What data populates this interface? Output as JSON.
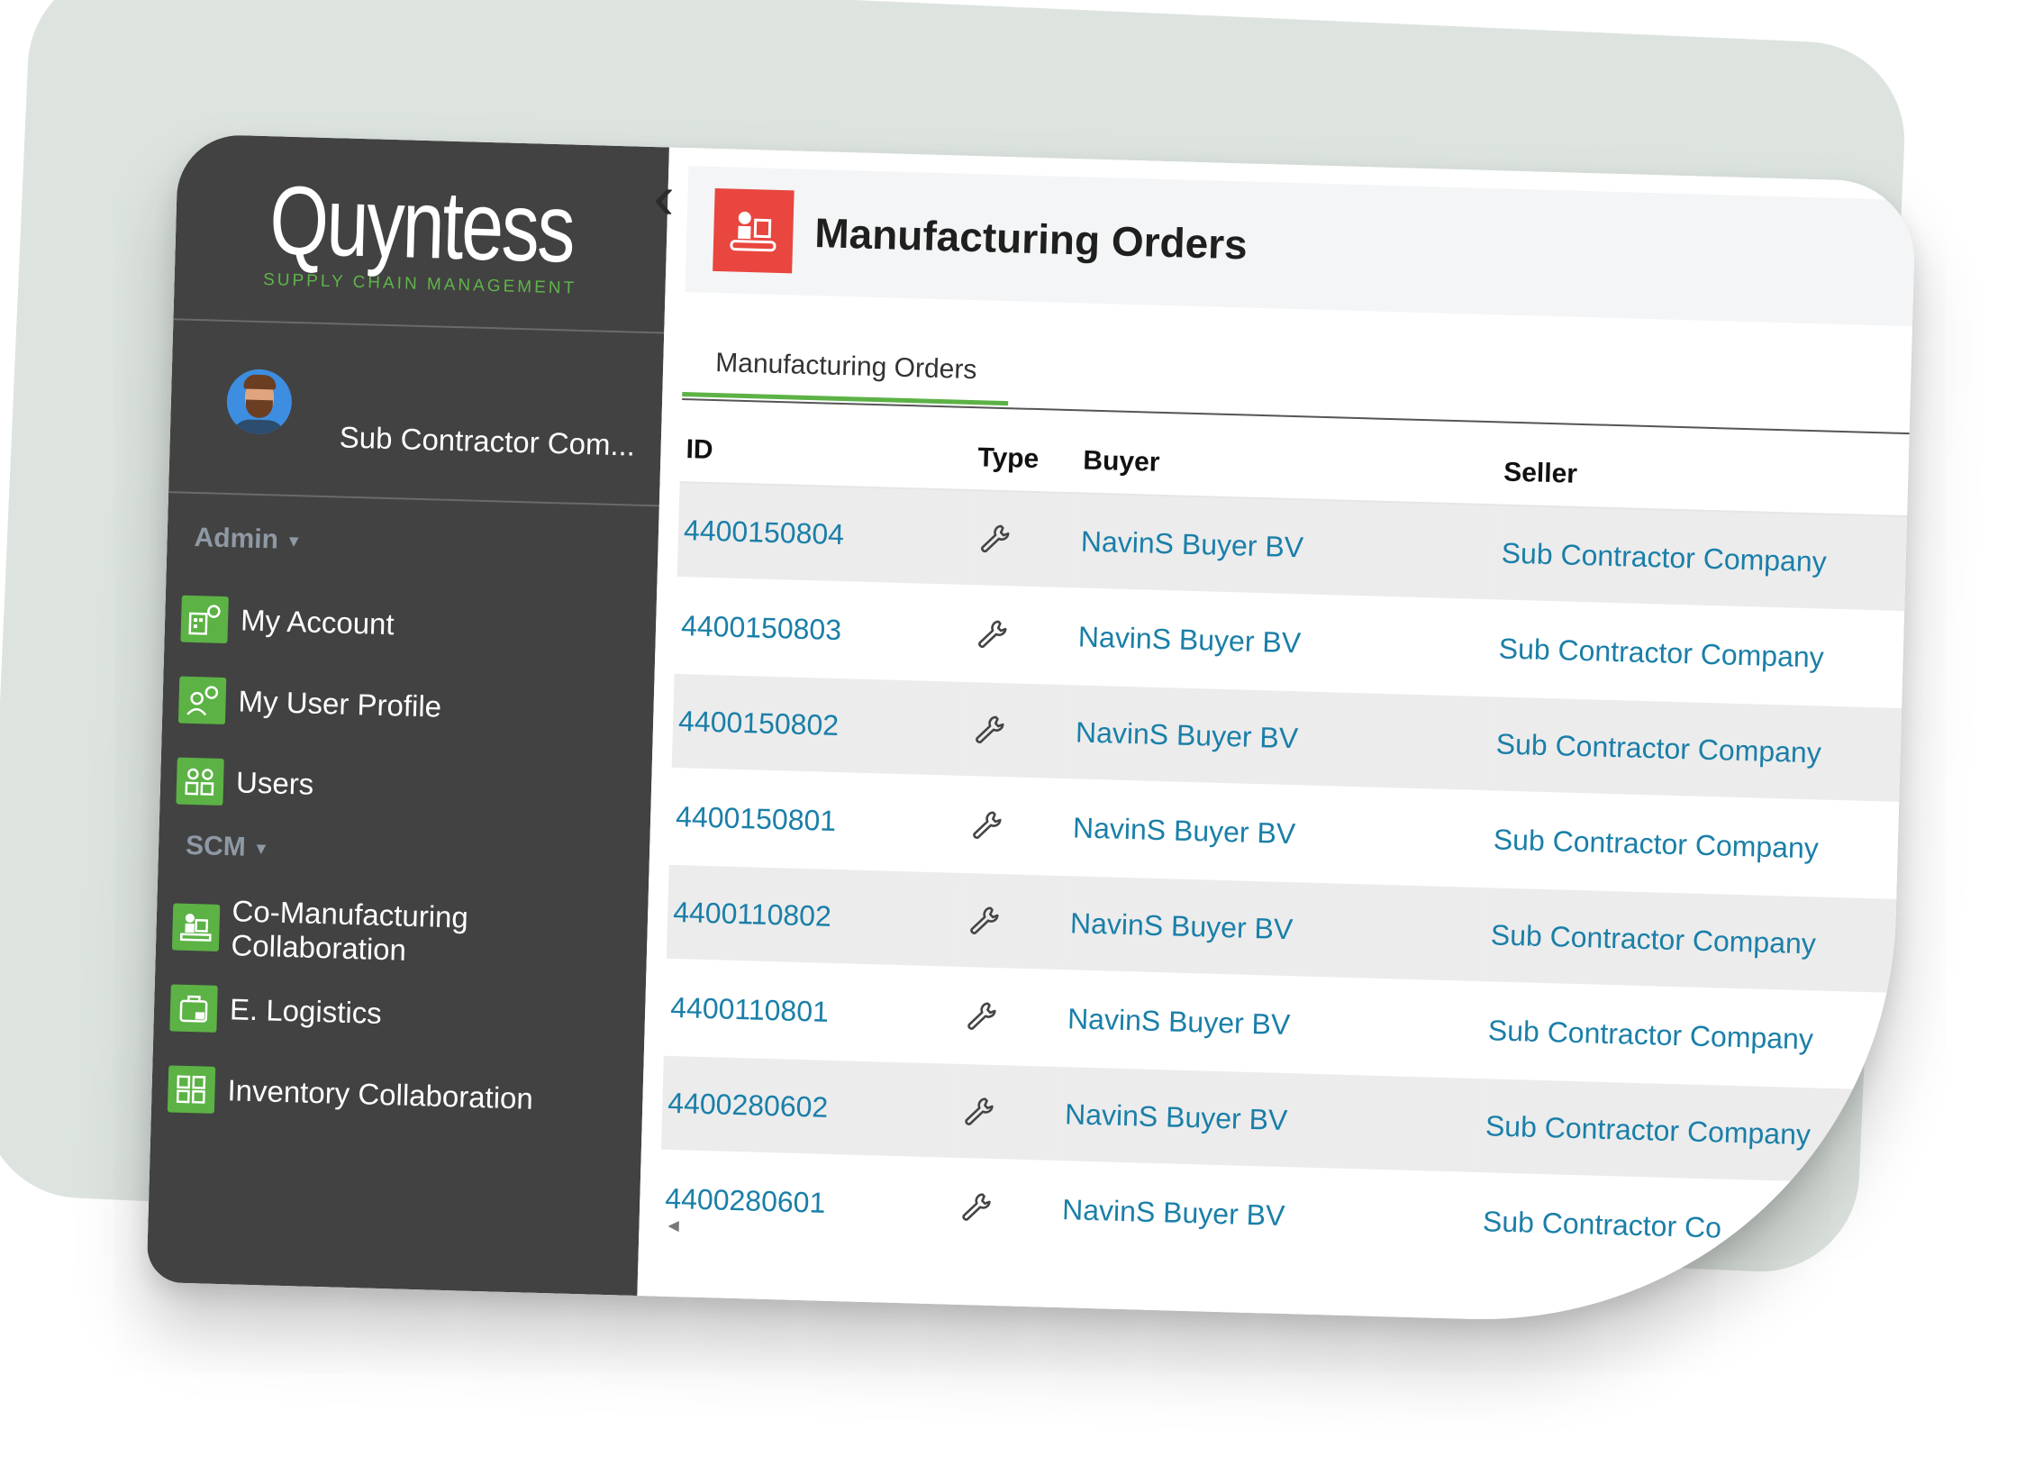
{
  "app": {
    "logo": "Quyntess",
    "tagline": "SUPPLY CHAIN MANAGEMENT",
    "brand_green": "#5cb245",
    "sidebar_bg": "#424242",
    "accent_red": "#e8463f",
    "link_color": "#1a7fa8"
  },
  "user": {
    "name": "Sub Contractor Com..."
  },
  "sidebar": {
    "sections": [
      {
        "label": "Admin",
        "items": [
          {
            "label": "My Account",
            "icon": "account-settings-icon"
          },
          {
            "label": "My User Profile",
            "icon": "user-settings-icon"
          },
          {
            "label": "Users",
            "icon": "users-icon"
          }
        ]
      },
      {
        "label": "SCM",
        "items": [
          {
            "label": "Co-Manufacturing Collaboration",
            "icon": "manufacturing-icon"
          },
          {
            "label": "E. Logistics",
            "icon": "logistics-icon"
          },
          {
            "label": "Inventory Collaboration",
            "icon": "inventory-icon"
          }
        ]
      }
    ]
  },
  "header": {
    "title": "Manufacturing Orders",
    "icon": "manufacturing-orders-icon"
  },
  "tabs": [
    {
      "label": "Manufacturing Orders",
      "active": true
    }
  ],
  "table": {
    "columns": [
      "ID",
      "Type",
      "Buyer",
      "Seller"
    ],
    "rows": [
      {
        "id": "4400150804",
        "type": "wrench-icon",
        "buyer": "NavinS Buyer BV",
        "seller": "Sub Contractor Company"
      },
      {
        "id": "4400150803",
        "type": "wrench-icon",
        "buyer": "NavinS Buyer BV",
        "seller": "Sub Contractor Company"
      },
      {
        "id": "4400150802",
        "type": "wrench-icon",
        "buyer": "NavinS Buyer BV",
        "seller": "Sub Contractor Company"
      },
      {
        "id": "4400150801",
        "type": "wrench-icon",
        "buyer": "NavinS Buyer BV",
        "seller": "Sub Contractor Company"
      },
      {
        "id": "4400110802",
        "type": "wrench-icon",
        "buyer": "NavinS Buyer BV",
        "seller": "Sub Contractor Company"
      },
      {
        "id": "4400110801",
        "type": "wrench-icon",
        "buyer": "NavinS Buyer BV",
        "seller": "Sub Contractor Company"
      },
      {
        "id": "4400280602",
        "type": "wrench-icon",
        "buyer": "NavinS Buyer BV",
        "seller": "Sub Contractor Company"
      },
      {
        "id": "4400280601",
        "type": "wrench-icon",
        "buyer": "NavinS Buyer BV",
        "seller": "Sub Contractor Co"
      }
    ]
  }
}
